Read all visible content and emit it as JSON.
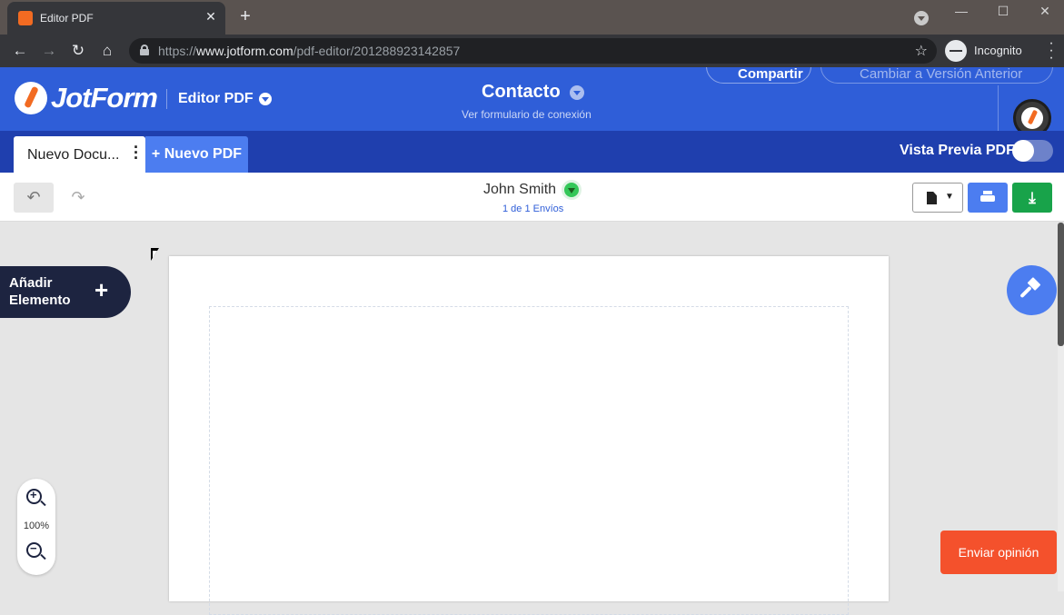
{
  "browser": {
    "tab_title": "Editor PDF",
    "tab_favicon": "jotform-icon",
    "url_prefix": "https://",
    "url_domain": "www.jotform.com",
    "url_path": "/pdf-editor/201288923142857",
    "profile_label": "Incognito"
  },
  "header": {
    "logo_text": "JotForm",
    "app_label": "Editor PDF",
    "form_title": "Contacto",
    "form_subtitle": "Ver formulario de conexión",
    "share_label": "Compartir",
    "revert_label": "Cambiar a Versión Anterior"
  },
  "docbar": {
    "doc_tab_label": "Nuevo Docu...",
    "new_pdf_label": "+ Nuevo PDF",
    "preview_label": "Vista Previa PDF",
    "preview_enabled": false
  },
  "editor": {
    "submitter_name": "John Smith",
    "submission_count": "1 de 1 Envíos"
  },
  "canvas": {
    "add_element_label": "Añadir Elemento",
    "zoom_level": "100%",
    "feedback_label": "Enviar opinión"
  },
  "colors": {
    "brand_blue": "#2f5ed8",
    "brand_dark_blue": "#1f3fae",
    "accent_blue": "#4c7df0",
    "jotform_orange": "#f26b22",
    "download_green": "#18a34a",
    "feedback_red": "#f4512c"
  }
}
